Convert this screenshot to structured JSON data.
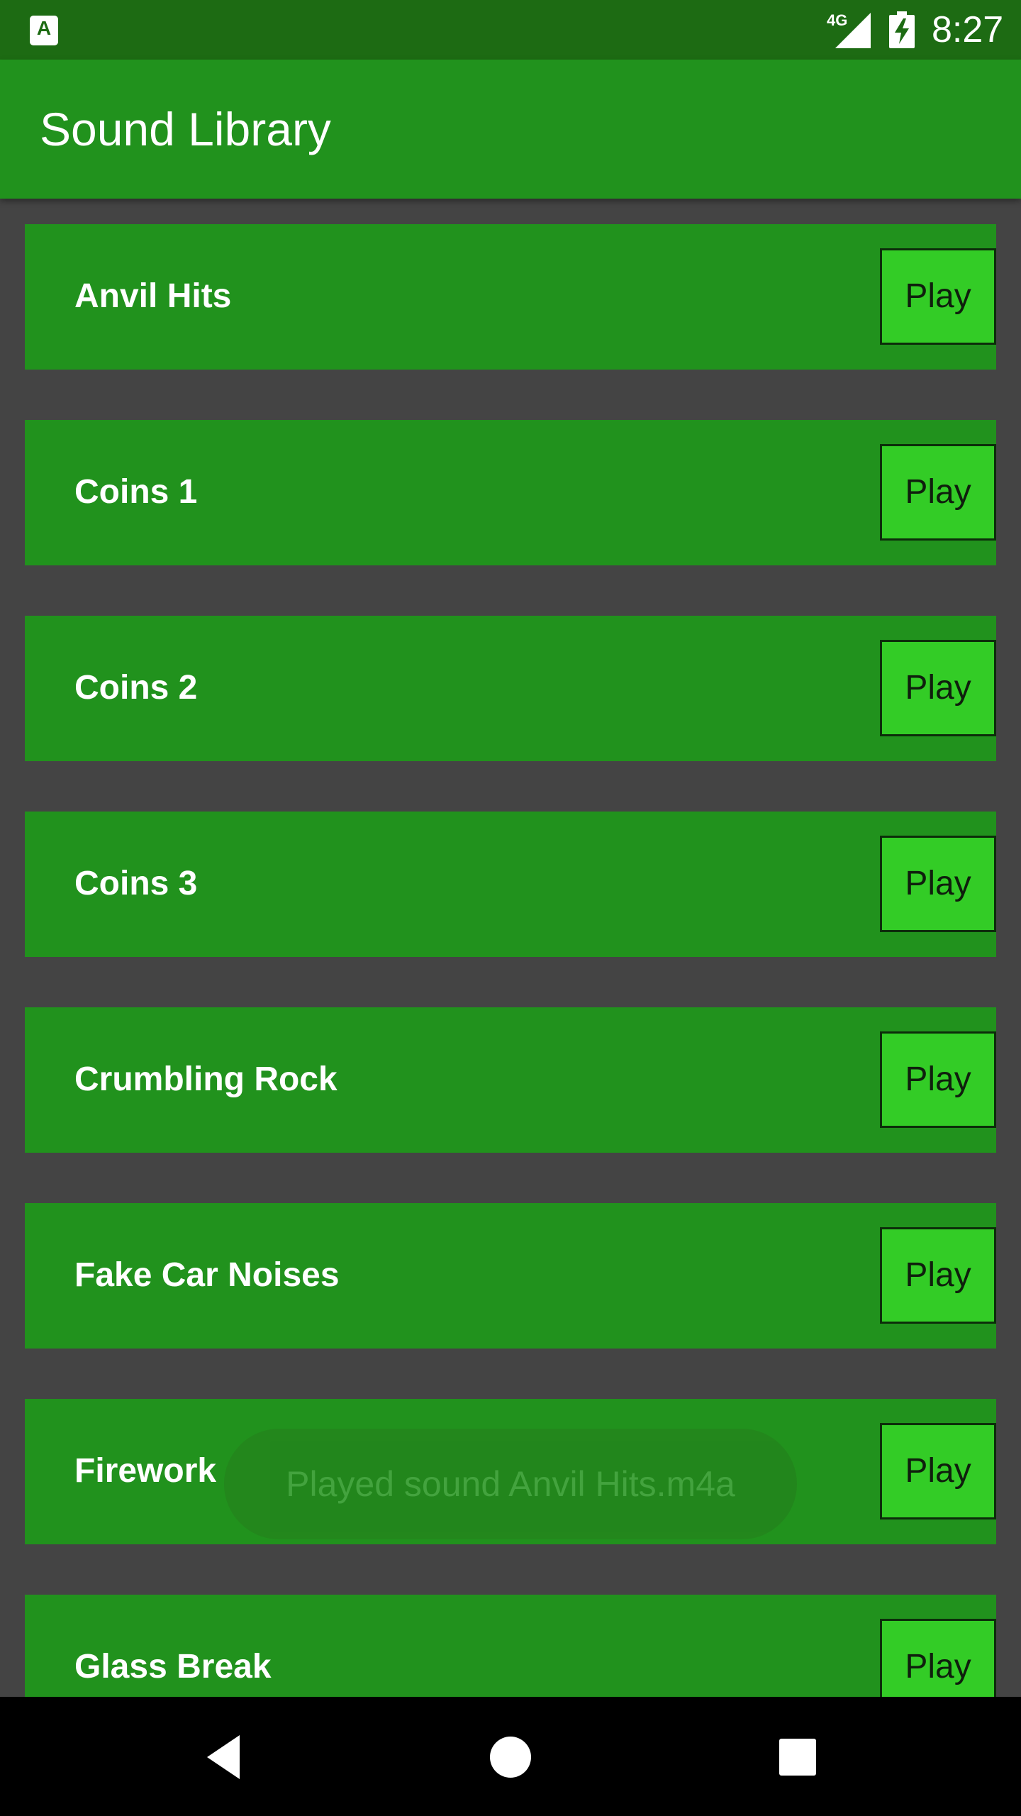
{
  "status_bar": {
    "app_icon": "A",
    "network": "4G",
    "time": "8:27",
    "icons": [
      "app-notification-icon",
      "signal-icon",
      "battery-charging-icon"
    ]
  },
  "app_bar": {
    "title": "Sound Library"
  },
  "sounds": [
    {
      "name": "Anvil Hits",
      "button_label": "Play"
    },
    {
      "name": "Coins 1",
      "button_label": "Play"
    },
    {
      "name": "Coins 2",
      "button_label": "Play"
    },
    {
      "name": "Coins 3",
      "button_label": "Play"
    },
    {
      "name": "Crumbling Rock",
      "button_label": "Play"
    },
    {
      "name": "Fake Car Noises",
      "button_label": "Play"
    },
    {
      "name": "Firework",
      "button_label": "Play"
    },
    {
      "name": "Glass Break",
      "button_label": "Play"
    }
  ],
  "toast": {
    "message": "Played sound Anvil Hits.m4a"
  },
  "nav_bar": {
    "icons": [
      "back-icon",
      "home-icon",
      "recents-icon"
    ]
  },
  "colors": {
    "status_bar": "#1d6b13",
    "app_bar": "#21921d",
    "row": "#21921d",
    "play_button": "#33cc26",
    "background": "#444444"
  }
}
